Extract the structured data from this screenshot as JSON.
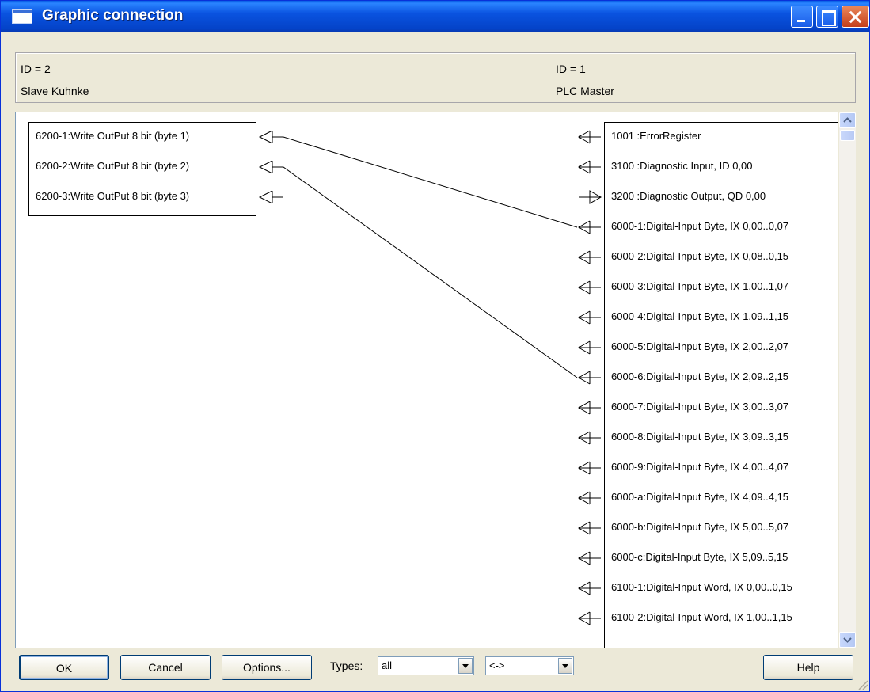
{
  "window": {
    "title": "Graphic connection"
  },
  "header": {
    "slave_id": "ID = 2",
    "slave_name": "Slave Kuhnke",
    "master_id": "ID = 1",
    "master_name": "PLC Master"
  },
  "slave_objects": [
    "6200-1:Write OutPut 8 bit (byte 1)",
    "6200-2:Write OutPut 8 bit (byte 2)",
    "6200-3:Write OutPut 8 bit (byte 3)"
  ],
  "master_objects": [
    "1001  :ErrorRegister",
    "3100  :Diagnostic Input, ID 0,00",
    "3200  :Diagnostic Output, QD 0,00",
    "6000-1:Digital-Input Byte, IX 0,00..0,07",
    "6000-2:Digital-Input Byte, IX 0,08..0,15",
    "6000-3:Digital-Input Byte, IX 1,00..1,07",
    "6000-4:Digital-Input Byte, IX 1,09..1,15",
    "6000-5:Digital-Input Byte, IX 2,00..2,07",
    "6000-6:Digital-Input Byte, IX 2,09..2,15",
    "6000-7:Digital-Input Byte, IX 3,00..3,07",
    "6000-8:Digital-Input Byte, IX 3,09..3,15",
    "6000-9:Digital-Input Byte, IX 4,00..4,07",
    "6000-a:Digital-Input Byte, IX 4,09..4,15",
    "6000-b:Digital-Input Byte, IX 5,00..5,07",
    "6000-c:Digital-Input Byte, IX 5,09..5,15",
    "6100-1:Digital-Input Word, IX 0,00..0,15",
    "6100-2:Digital-Input Word, IX 1,00..1,15"
  ],
  "master_directions": [
    "in",
    "in",
    "out",
    "in",
    "in",
    "in",
    "in",
    "in",
    "in",
    "in",
    "in",
    "in",
    "in",
    "in",
    "in",
    "in",
    "in"
  ],
  "connections": [
    {
      "from": 0,
      "to": 3
    },
    {
      "from": 1,
      "to": 8
    }
  ],
  "footer": {
    "ok": "OK",
    "cancel": "Cancel",
    "options": "Options...",
    "types_label": "Types:",
    "types_value": "all",
    "direction_value": "<->",
    "help": "Help"
  }
}
